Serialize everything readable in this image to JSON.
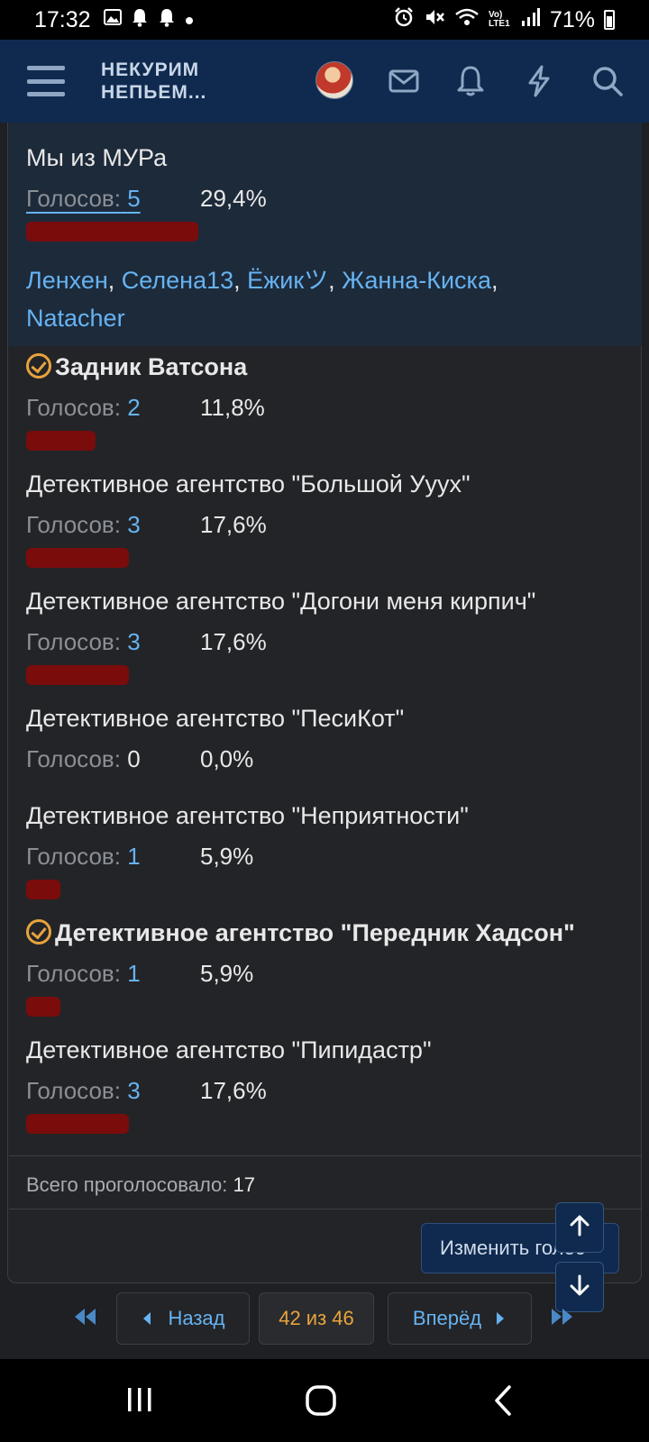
{
  "status_bar": {
    "time": "17:32",
    "battery": "71%",
    "left_icons": [
      "image-icon",
      "bell-icon",
      "bell-icon",
      "dot-icon"
    ],
    "right_icons": [
      "alarm-icon",
      "mute-icon",
      "wifi-icon",
      "volte-lte-icon",
      "signal-icon",
      "battery-icon"
    ],
    "network_label": "Vo) LTE1"
  },
  "header": {
    "logo_line1": "НЕКУРИМ",
    "logo_line2": "НЕПЬЕМ...",
    "icons": [
      "menu-icon",
      "avatar",
      "mail-icon",
      "bell-icon",
      "bolt-icon",
      "search-icon"
    ]
  },
  "poll": {
    "votes_label": "Голосов:",
    "options": [
      {
        "title": "Мы из МУРа",
        "votes": "5",
        "percent": "29,4%",
        "bar_fraction": 0.294,
        "voted_by_user": false,
        "highlighted": true,
        "voters": [
          "Ленхен",
          "Селена13",
          "Ёжикツ",
          "Жанна-Киска",
          "Natacher"
        ]
      },
      {
        "title": "Задник Ватсона",
        "votes": "2",
        "percent": "11,8%",
        "bar_fraction": 0.118,
        "voted_by_user": true
      },
      {
        "title": "Детективное агентство \"Большой Ууух\"",
        "votes": "3",
        "percent": "17,6%",
        "bar_fraction": 0.176,
        "voted_by_user": false
      },
      {
        "title": "Детективное агентство \"Догони меня кирпич\"",
        "votes": "3",
        "percent": "17,6%",
        "bar_fraction": 0.176,
        "voted_by_user": false
      },
      {
        "title": "Детективное агентство \"ПесиКот\"",
        "votes": "0",
        "percent": "0,0%",
        "bar_fraction": 0,
        "voted_by_user": false
      },
      {
        "title": "Детективное агентство \"Неприятности\"",
        "votes": "1",
        "percent": "5,9%",
        "bar_fraction": 0.059,
        "voted_by_user": false
      },
      {
        "title": "Детективное агентство \"Передник Хадсон\"",
        "votes": "1",
        "percent": "5,9%",
        "bar_fraction": 0.059,
        "voted_by_user": true
      },
      {
        "title": "Детективное агентство \"Пипидастр\"",
        "votes": "3",
        "percent": "17,6%",
        "bar_fraction": 0.176,
        "voted_by_user": false
      }
    ],
    "total_label": "Всего проголосовало:",
    "total_value": "17",
    "change_vote_label": "Изменить голос"
  },
  "pagination": {
    "prev_label": "Назад",
    "current_label": "42 из 46",
    "next_label": "Вперёд"
  },
  "colors": {
    "header_bg": "#0f2a4e",
    "bar": "#7a0c0c",
    "link": "#66b3f2",
    "accent": "#e8a33d",
    "panel_bg": "#232427",
    "highlight_bg": "#1d2a3a"
  }
}
